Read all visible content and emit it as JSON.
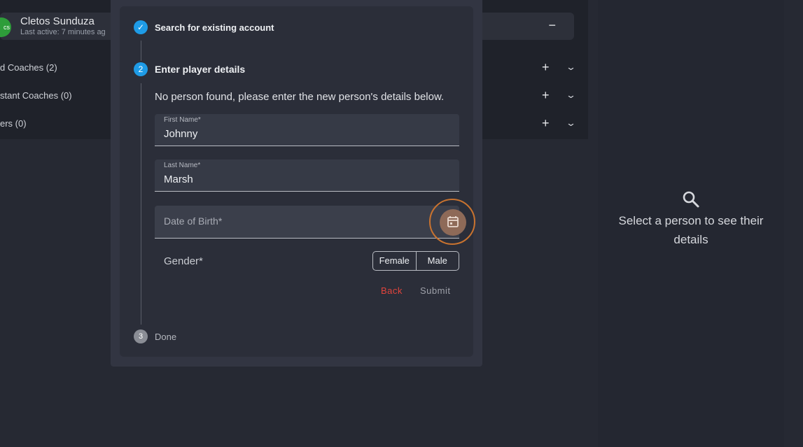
{
  "background": {
    "person": {
      "avatar_text": "cs",
      "name": "Cletos Sunduza",
      "last_active": "Last active: 7 minutes ag",
      "collapse_symbol": "−"
    },
    "roles": [
      {
        "label": "d Coaches (2)",
        "plus": "+",
        "chevron": "⌄"
      },
      {
        "label": "stant Coaches (0)",
        "plus": "+",
        "chevron": "⌄"
      },
      {
        "label": "ers (0)",
        "plus": "+",
        "chevron": "⌄"
      }
    ]
  },
  "right_pane": {
    "icon": "search-icon",
    "message": "Select a person to see their details"
  },
  "stepper": {
    "steps": [
      {
        "number": "✓",
        "title": "Search for existing account",
        "state": "completed"
      },
      {
        "number": "2",
        "title": "Enter player details",
        "state": "active"
      },
      {
        "number": "3",
        "title": "Done",
        "state": "pending"
      }
    ],
    "info": "No person found, please enter the new person's details below.",
    "first_name": {
      "label": "First Name*",
      "value": "Johnny"
    },
    "last_name": {
      "label": "Last Name*",
      "value": "Marsh"
    },
    "dob": {
      "placeholder": "Date of Birth*",
      "icon": "calendar-icon"
    },
    "gender": {
      "label": "Gender*",
      "options": [
        "Female",
        "Male"
      ]
    },
    "back_label": "Back",
    "submit_label": "Submit"
  },
  "colors": {
    "accent": "#1e9be6",
    "focus_ring": "#c9732f",
    "danger": "#e2443c"
  }
}
